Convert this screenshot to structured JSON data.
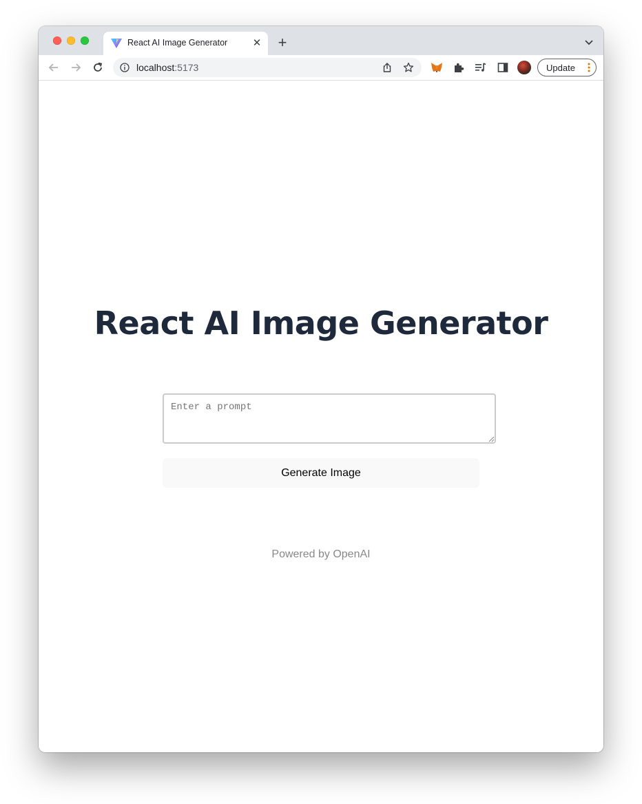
{
  "browser": {
    "tab": {
      "title": "React AI Image Generator"
    },
    "address_bar": {
      "host": "localhost",
      "port": ":5173"
    },
    "update_label": "Update"
  },
  "page": {
    "heading": "React AI Image Generator",
    "prompt_placeholder": "Enter a prompt",
    "prompt_value": "",
    "generate_label": "Generate Image",
    "footer": "Powered by OpenAI"
  },
  "colors": {
    "heading": "#1e293b",
    "button_bg": "#f9f9f9",
    "footer_text": "#888888"
  }
}
